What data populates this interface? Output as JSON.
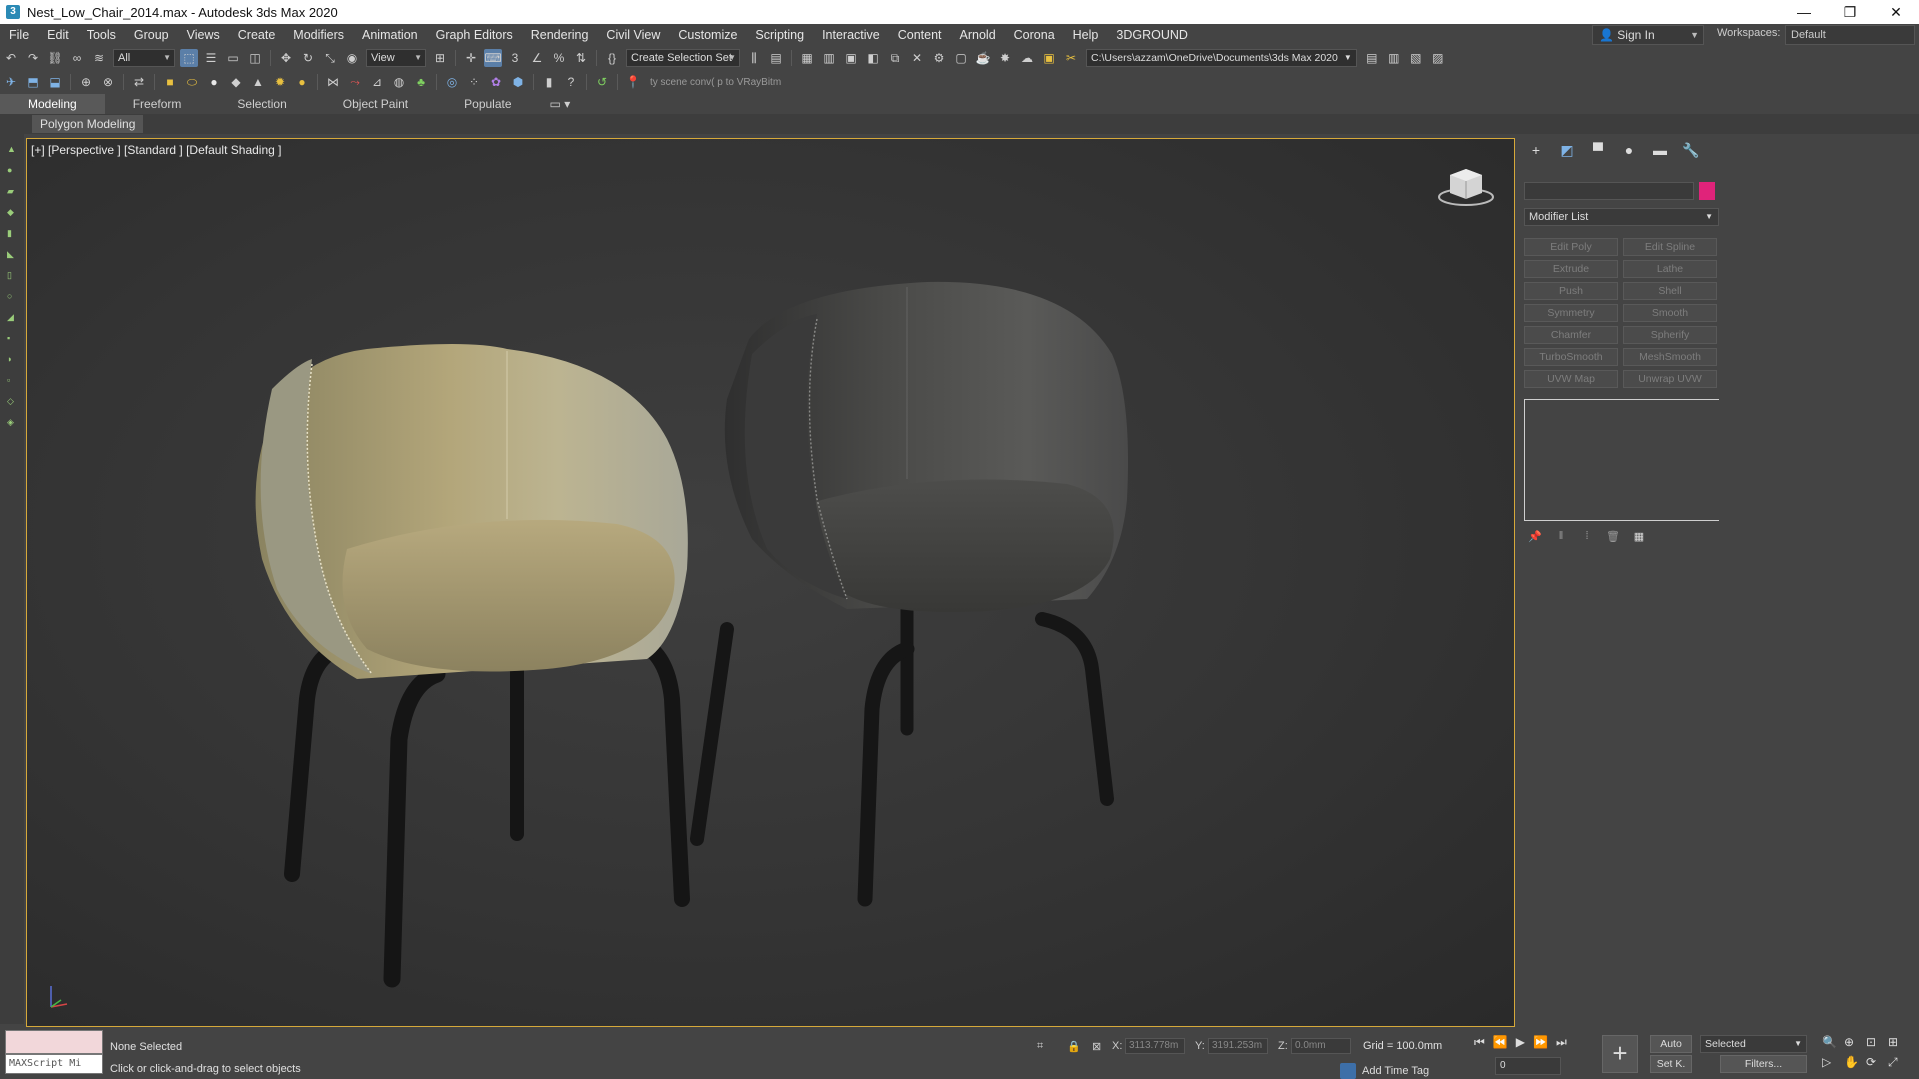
{
  "window": {
    "title": "Nest_Low_Chair_2014.max - Autodesk 3ds Max 2020",
    "minimize": "—",
    "maximize": "❐",
    "close": "✕"
  },
  "menu": [
    "File",
    "Edit",
    "Tools",
    "Group",
    "Views",
    "Create",
    "Modifiers",
    "Animation",
    "Graph Editors",
    "Rendering",
    "Civil View",
    "Customize",
    "Scripting",
    "Interactive",
    "Content",
    "Arnold",
    "Corona",
    "Help",
    "3DGROUND"
  ],
  "account": {
    "sign_in": "Sign In",
    "workspaces_label": "Workspaces:",
    "workspace": "Default"
  },
  "toolbar": {
    "filter": "All",
    "ref_coord": "View",
    "selection_set": "Create Selection Set",
    "project_path": "C:\\Users\\azzam\\OneDrive\\Documents\\3ds Max 2020",
    "script_hint": "ty scene conv( p to VRayBitm"
  },
  "ribbon": {
    "tabs": [
      "Modeling",
      "Freeform",
      "Selection",
      "Object Paint",
      "Populate"
    ],
    "active": "Modeling",
    "sub": "Polygon Modeling"
  },
  "viewport": {
    "label": "[+] [Perspective ] [Standard ] [Default Shading ]"
  },
  "command_panel": {
    "modifier_list": "Modifier List",
    "color_swatch": "#e0237a",
    "buttons": [
      "Edit Poly",
      "Edit Spline",
      "Extrude",
      "Lathe",
      "Push",
      "Shell",
      "Symmetry",
      "Smooth",
      "Chamfer",
      "Spherify",
      "TurboSmooth",
      "MeshSmooth",
      "UVW Map",
      "Unwrap UVW"
    ]
  },
  "status": {
    "maxscript": "MAXScript Mi",
    "selection": "None Selected",
    "prompt": "Click or click-and-drag to select objects",
    "x_label": "X:",
    "x": "3113.778m",
    "y_label": "Y:",
    "y": "3191.253m",
    "z_label": "Z:",
    "z": "0.0mm",
    "grid": "Grid = 100.0mm",
    "add_time_tag": "Add Time Tag",
    "frame": "0",
    "auto": "Auto",
    "set_key": "Set K.",
    "selected": "Selected",
    "filters": "Filters..."
  }
}
